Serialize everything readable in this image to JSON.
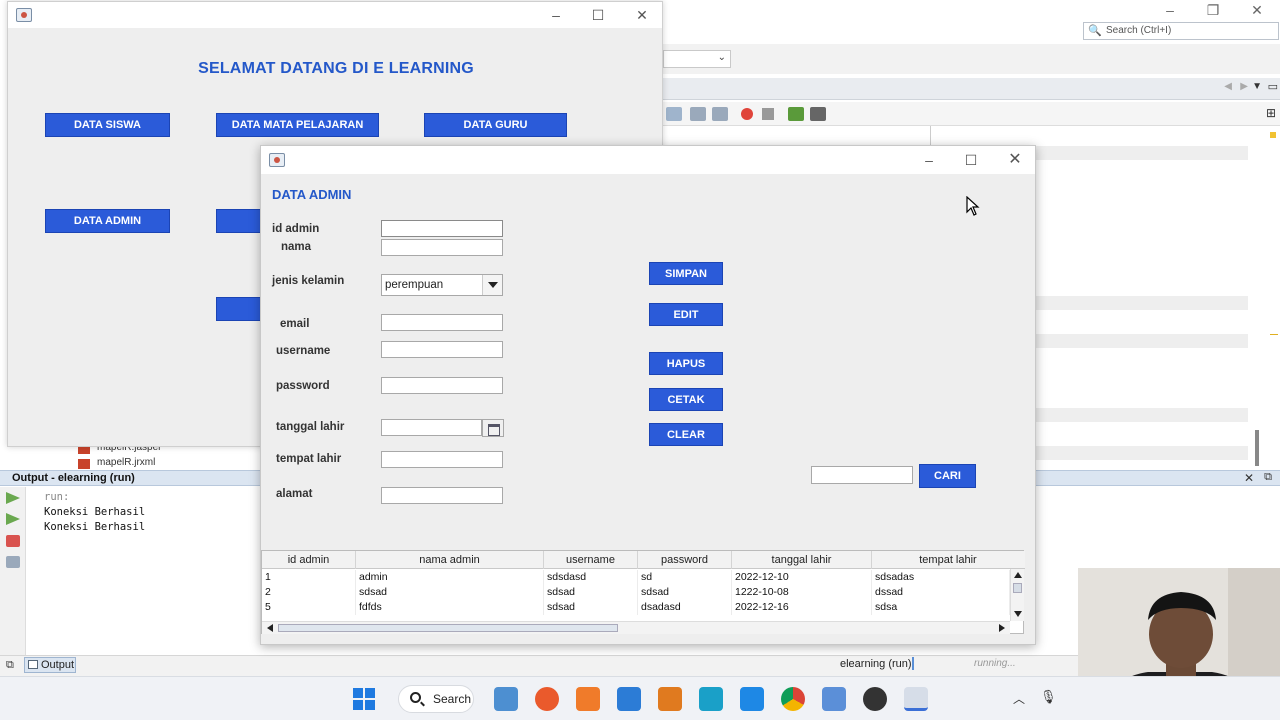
{
  "ide": {
    "search_placeholder": "Search (Ctrl+I)",
    "tree_items": [
      "mapelR.jasper",
      "mapelR.jrxml"
    ],
    "output_title": "Output - elearning (run)",
    "output_lines": [
      "run:",
      "Koneksi Berhasil",
      "Koneksi Berhasil"
    ],
    "output_tab_label": "Output",
    "status_run": "elearning (run)",
    "status_progress": "running..."
  },
  "main_window": {
    "heading": "SELAMAT DATANG DI E LEARNING",
    "buttons": {
      "data_siswa": "DATA SISWA",
      "data_mata_pelajaran": "DATA MATA PELAJARAN",
      "data_guru": "DATA GURU",
      "data_admin": "DATA ADMIN"
    }
  },
  "admin_window": {
    "heading": "DATA ADMIN",
    "labels": {
      "id_admin": "id admin",
      "nama": "nama",
      "jenis_kelamin": "jenis kelamin",
      "email": "email",
      "username": "username",
      "password": "password",
      "tanggal_lahir": "tanggal lahir",
      "tempat_lahir": "tempat lahir",
      "alamat": "alamat"
    },
    "values": {
      "id_admin": "",
      "nama": "",
      "jenis_kelamin": "perempuan",
      "email": "",
      "username": "",
      "password": "",
      "tanggal_lahir": "",
      "tempat_lahir": "",
      "alamat": "",
      "cari": ""
    },
    "buttons": {
      "simpan": "SIMPAN",
      "edit": "EDIT",
      "hapus": "HAPUS",
      "cetak": "CETAK",
      "clear": "CLEAR",
      "cari": "CARI"
    },
    "table": {
      "columns": [
        "id admin",
        "nama admin",
        "username",
        "password",
        "tanggal lahir",
        "tempat lahir"
      ],
      "rows": [
        [
          "1",
          "admin",
          "sdsdasd",
          "sd",
          "2022-12-10",
          "sdsadas"
        ],
        [
          "2",
          "sdsad",
          "sdsad",
          "sdsad",
          "1222-10-08",
          "dssad"
        ],
        [
          "5",
          "fdfds",
          "sdsad",
          "dsadasd",
          "2022-12-16",
          "sdsa"
        ]
      ]
    }
  },
  "taskbar": {
    "search_label": "Search"
  },
  "colors": {
    "accent_blue": "#2b5bd9",
    "heading_blue": "#2458c9"
  }
}
